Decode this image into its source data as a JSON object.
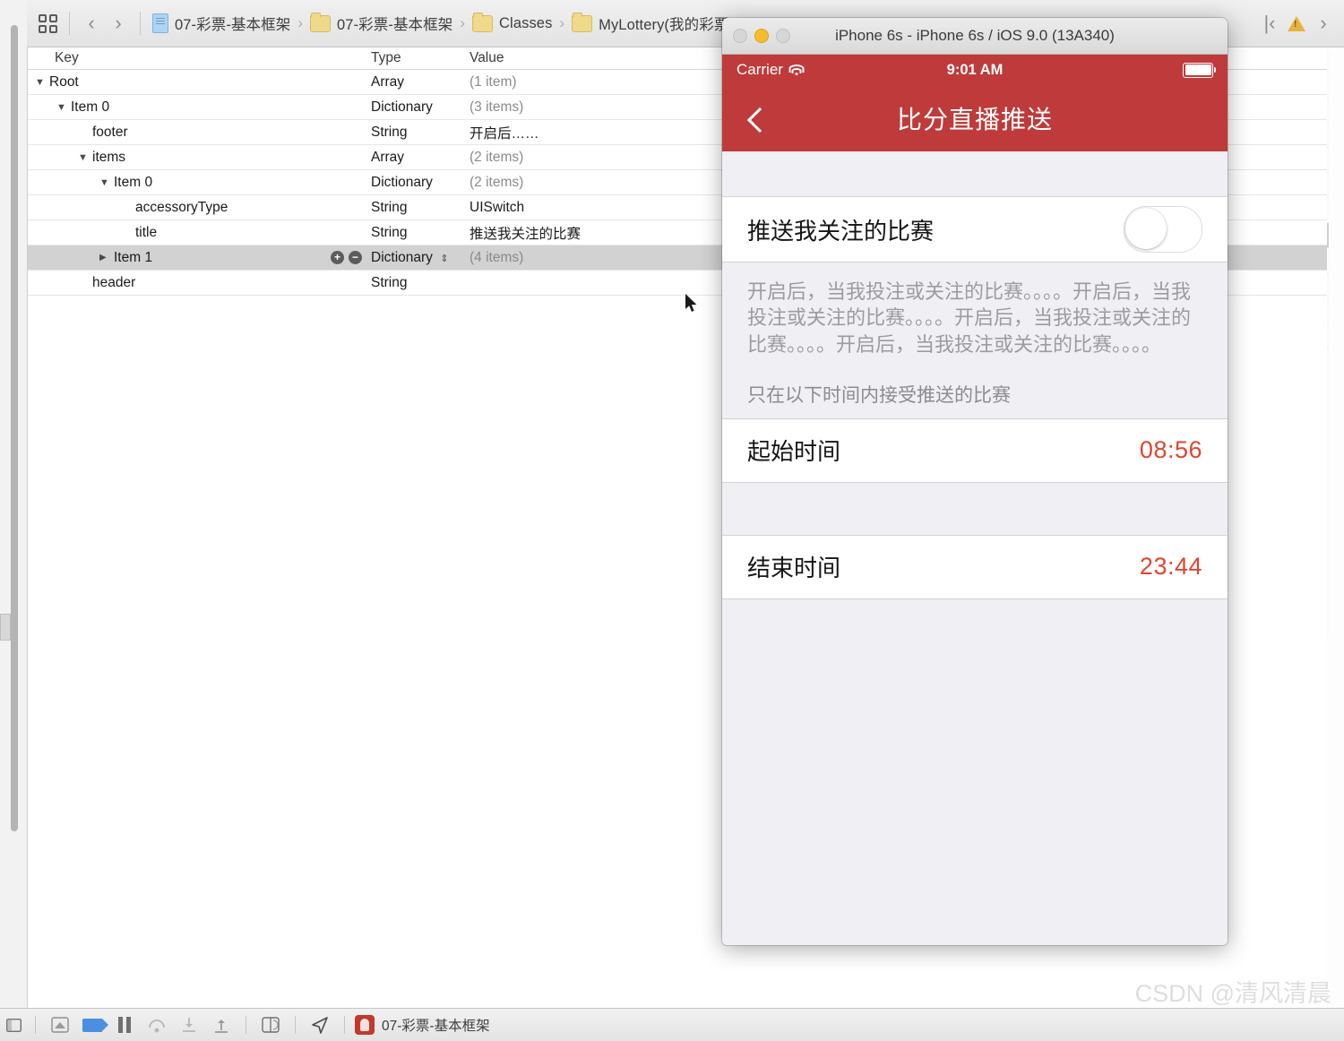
{
  "xcode": {
    "toolbar": {
      "grid_button": "editor-layout",
      "back": "‹",
      "forward": "›",
      "breadcrumbs": [
        {
          "icon": "document-icon",
          "label": "07-彩票-基本框架"
        },
        {
          "icon": "folder-icon",
          "label": "07-彩票-基本框架"
        },
        {
          "icon": "folder-icon",
          "label": "Classes"
        },
        {
          "icon": "folder-icon",
          "label": "MyLottery(我的彩票"
        }
      ],
      "separator": "›",
      "right": {
        "prev": "|‹",
        "warning_icon": "warning-triangle-icon",
        "next": "›"
      }
    },
    "plist": {
      "columns": {
        "key": "Key",
        "type": "Type",
        "value": "Value"
      },
      "rows": [
        {
          "indent": 0,
          "disclosure": "down",
          "key": "Root",
          "type": "Array",
          "value": "(1 item)",
          "selected": false,
          "muted": true
        },
        {
          "indent": 1,
          "disclosure": "down",
          "key": "Item 0",
          "type": "Dictionary",
          "value": "(3 items)",
          "selected": false,
          "muted": true
        },
        {
          "indent": 2,
          "disclosure": "none",
          "key": "footer",
          "type": "String",
          "value": "开启后……",
          "selected": false,
          "muted": false
        },
        {
          "indent": 2,
          "disclosure": "down",
          "key": "items",
          "type": "Array",
          "value": "(2 items)",
          "selected": false,
          "muted": true
        },
        {
          "indent": 3,
          "disclosure": "down",
          "key": "Item 0",
          "type": "Dictionary",
          "value": "(2 items)",
          "selected": false,
          "muted": true
        },
        {
          "indent": 4,
          "disclosure": "none",
          "key": "accessoryType",
          "type": "String",
          "value": "UISwitch",
          "selected": false,
          "muted": false
        },
        {
          "indent": 4,
          "disclosure": "none",
          "key": "title",
          "type": "String",
          "value": "推送我关注的比赛",
          "selected": false,
          "muted": false
        },
        {
          "indent": 3,
          "disclosure": "right",
          "key": "Item 1",
          "type": "Dictionary",
          "value": "(4 items)",
          "selected": true,
          "muted": true
        },
        {
          "indent": 2,
          "disclosure": "none",
          "key": "header",
          "type": "String",
          "value": "",
          "selected": false,
          "muted": false
        }
      ],
      "row_controls": {
        "add": "+",
        "remove": "−",
        "stepper": "⇕"
      }
    },
    "debug_bar": {
      "icons": [
        "breakpoint-list-icon",
        "breakpoint-flag-icon",
        "pause-icon",
        "step-over-icon",
        "step-into-icon",
        "step-out-icon",
        "view-debug-icon",
        "location-icon"
      ],
      "scheme_label": "07-彩票-基本框架"
    },
    "watermark": "CSDN @清风清晨"
  },
  "simulator": {
    "window_title": "iPhone 6s - iPhone 6s / iOS 9.0 (13A340)",
    "traffic_lights": [
      "close",
      "minimize",
      "zoom"
    ],
    "status_bar": {
      "carrier": "Carrier",
      "wifi_icon": "wifi-icon",
      "time": "9:01 AM",
      "battery_icon": "battery-full-icon"
    },
    "nav_bar": {
      "back_icon": "back-chevron-icon",
      "title": "比分直播推送",
      "tint": "#bf3a3a"
    },
    "screen": {
      "switch_cell": {
        "label": "推送我关注的比赛",
        "switch_state": "off",
        "switch_name": "push-followed-matches-switch"
      },
      "footer_text": "开启后，当我投注或关注的比赛。。。。开启后，当我投注或关注的比赛。。。。开启后，当我投注或关注的比赛。。。。开启后，当我投注或关注的比赛。。。。",
      "section_header": "只在以下时间内接受推送的比赛",
      "time_rows": [
        {
          "label": "起始时间",
          "value": "08:56",
          "name": "start-time-cell"
        },
        {
          "label": "结束时间",
          "value": "23:44",
          "name": "end-time-cell"
        }
      ],
      "accent_color": "#e0452e"
    }
  }
}
